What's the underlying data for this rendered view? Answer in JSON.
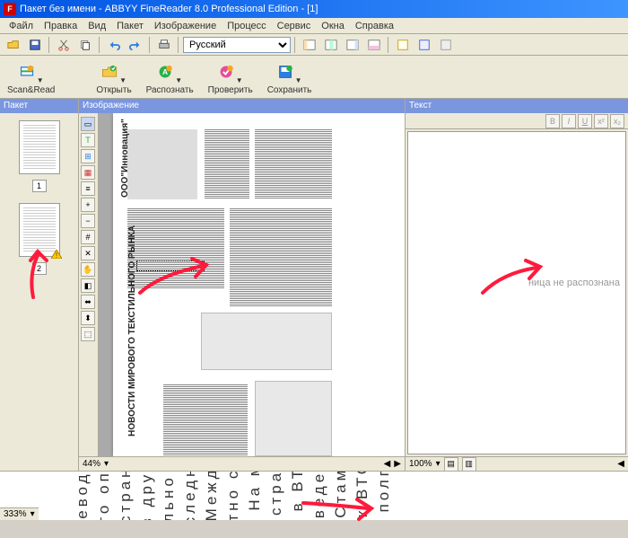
{
  "titlebar": {
    "icon_text": "F",
    "text": "Пакет без имени - ABBYY FineReader 8.0 Professional Edition - [1]"
  },
  "menubar": [
    "Файл",
    "Правка",
    "Вид",
    "Пакет",
    "Изображение",
    "Процесс",
    "Сервис",
    "Окна",
    "Справка"
  ],
  "toolbar1": {
    "language": "Русский"
  },
  "toolbar2": [
    {
      "label": "Scan&Read",
      "color": "#2a7de1"
    },
    {
      "label": "Открыть",
      "color": "#f5a623"
    },
    {
      "label": "Распознать",
      "color": "#2ab04a"
    },
    {
      "label": "Проверить",
      "color": "#e94b9a"
    },
    {
      "label": "Сохранить",
      "color": "#2a7de1"
    }
  ],
  "panels": {
    "paket": {
      "title": "Пакет",
      "thumbs": [
        {
          "num": "1"
        },
        {
          "num": "2"
        }
      ]
    },
    "image": {
      "title": "Изображение",
      "zoom": "44%"
    },
    "text": {
      "title": "Текст",
      "zoom": "100%",
      "not_recognized": "ница не распознана"
    }
  },
  "document": {
    "logo_text": "ООО\"Инновация\"",
    "heading": "НОВОСТИ МИРОВОГО ТЕКСТИЛЬНОГО РЫНКА"
  },
  "bottom": {
    "zoom": "333%",
    "fragments": [
      "евода",
      "го опы",
      "страна",
      "в други",
      "льно н",
      "следни",
      "Между",
      "тно со",
      ". На ми",
      ". страна",
      "в ВТ",
      "введено",
      ". Стамбу",
      "к ВТО",
      "полп"
    ]
  }
}
